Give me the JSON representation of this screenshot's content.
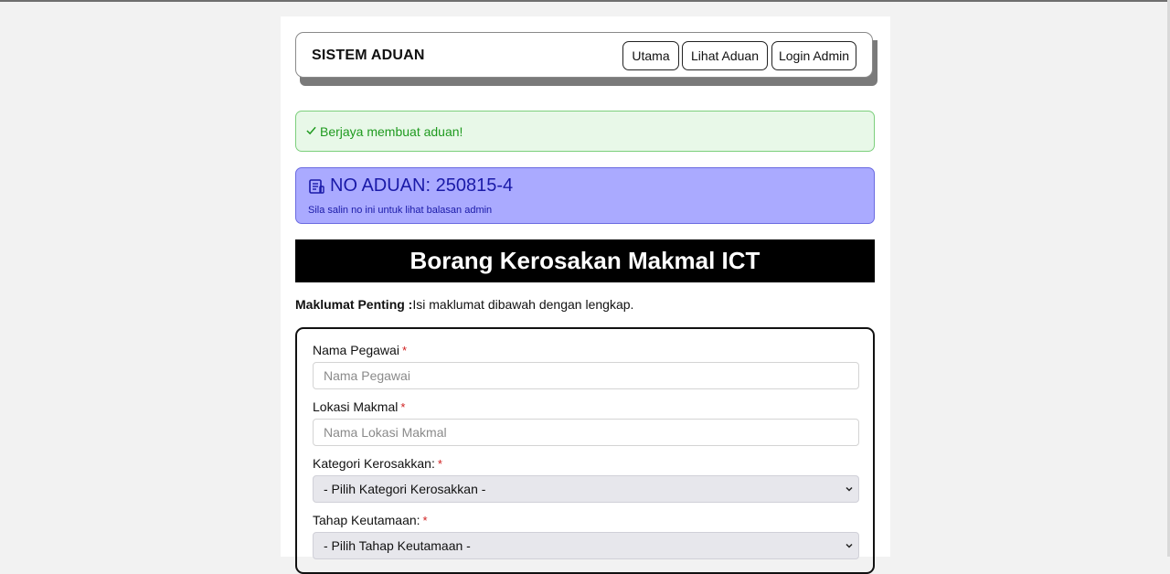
{
  "nav": {
    "brand": "SISTEM ADUAN",
    "buttons": [
      "Utama",
      "Lihat Aduan",
      "Login Admin"
    ]
  },
  "success_alert": {
    "icon": "check-icon",
    "message": "Berjaya membuat aduan!"
  },
  "complaint_alert": {
    "icon": "document-icon",
    "number": "NO ADUAN: 250815-4",
    "hint": "Sila salin no ini untuk lihat balasan admin"
  },
  "form": {
    "title": "Borang Kerosakan Makmal ICT",
    "important_label": "Maklumat Penting :",
    "important_text": "Isi maklumat dibawah dengan lengkap.",
    "required_mark": "*",
    "fields": {
      "nama_pegawai": {
        "label": "Nama Pegawai",
        "placeholder": "Nama Pegawai"
      },
      "lokasi_makmal": {
        "label": "Lokasi Makmal",
        "placeholder": "Nama Lokasi Makmal"
      },
      "kategori": {
        "label": "Kategori Kerosakkan:",
        "selected": "- Pilih Kategori Kerosakkan -"
      },
      "tahap": {
        "label": "Tahap Keutamaan:",
        "selected": "- Pilih Tahap Keutamaan -"
      }
    }
  },
  "colors": {
    "success_bg": "#e8f8e8",
    "success_text": "#1f9a1f",
    "info_bg": "#aaaaff",
    "info_text": "#1a1aa8",
    "title_bg": "#000000",
    "required": "#d02020"
  }
}
